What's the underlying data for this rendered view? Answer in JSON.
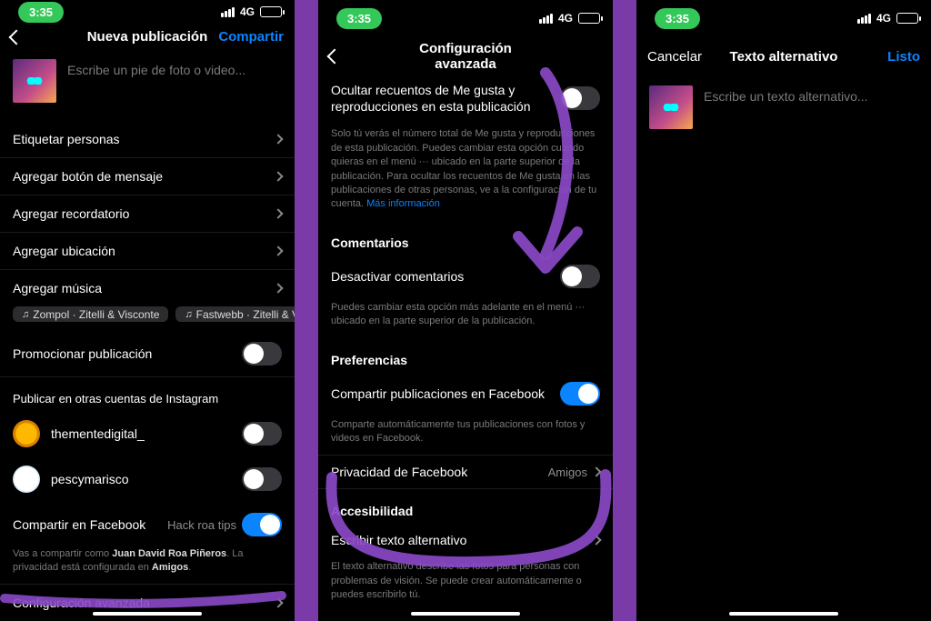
{
  "status": {
    "time": "3:35",
    "net": "4G"
  },
  "s1": {
    "title": "Nueva publicación",
    "action": "Compartir",
    "caption_ph": "Escribe un pie de foto o video...",
    "tag": "Etiquetar personas",
    "msgbtn": "Agregar botón de mensaje",
    "remind": "Agregar recordatorio",
    "location": "Agregar ubicación",
    "music": "Agregar música",
    "chip1": "Zompol · Zitelli & Visconte",
    "chip2": "Fastwebb · Zitelli & Visc",
    "promote": "Promocionar publicación",
    "other_accts": "Publicar en otras cuentas de Instagram",
    "acct1": "thementedigital_",
    "acct2": "pescymarisco",
    "sharefb": "Compartir en Facebook",
    "sharefb_val": "Hack roa tips",
    "fbnote1": "Vas a compartir como ",
    "fbname": "Juan David Roa Piñeros",
    "fbnote2": ". La privacidad está configurada en ",
    "fbpriv": "Amigos",
    "advanced": "Configuración avanzada"
  },
  "s2": {
    "title": "Configuración avanzada",
    "hide": "Ocultar recuentos de Me gusta y reproducciones en esta publicación",
    "hide_note": "Solo tú verás el número total de Me gusta y reproducciones de esta publicación. Puedes cambiar esta opción cuando quieras en el menú ··· ubicado en la parte superior de la publicación. Para ocultar los recuentos de Me gusta en las publicaciones de otras personas, ve a la configuración de tu cuenta. ",
    "hide_link": "Más información",
    "comments_h": "Comentarios",
    "comments_off": "Desactivar comentarios",
    "comments_note": "Puedes cambiar esta opción más adelante en el menú ··· ubicado en la parte superior de la publicación.",
    "prefs_h": "Preferencias",
    "sharefb": "Compartir publicaciones en Facebook",
    "sharefb_note": "Comparte automáticamente tus publicaciones con fotos y videos en Facebook.",
    "fbpriv": "Privacidad de Facebook",
    "fbpriv_val": "Amigos",
    "acc_h": "Accesibilidad",
    "alt": "Escribir texto alternativo",
    "alt_note": "El texto alternativo describe las fotos para personas con problemas de visión. Se puede crear automáticamente o puedes escribirlo tú."
  },
  "s3": {
    "cancel": "Cancelar",
    "title": "Texto alternativo",
    "done": "Listo",
    "ph": "Escribe un texto alternativo..."
  }
}
